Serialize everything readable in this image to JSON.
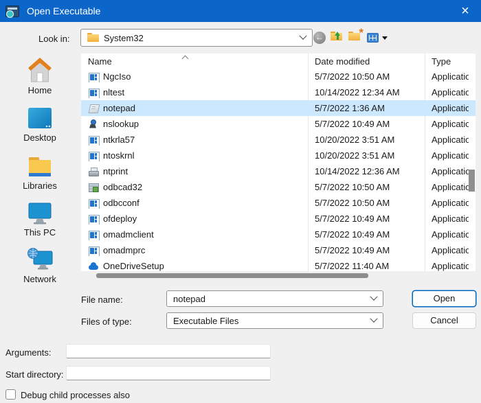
{
  "colors": {
    "titlebar": "#0c66ca",
    "selection": "#cce8ff",
    "accent": "#0067c0"
  },
  "window": {
    "title": "Open Executable",
    "close_glyph": "×"
  },
  "toolbar": {
    "look_in_label": "Look in:",
    "look_in_value": "System32",
    "nav_buttons": [
      "back-icon",
      "up-one-level-icon",
      "create-new-folder-icon",
      "view-menu-icon"
    ]
  },
  "sidebar": {
    "items": [
      {
        "label": "Home",
        "icon": "home-icon"
      },
      {
        "label": "Desktop",
        "icon": "desktop-icon"
      },
      {
        "label": "Libraries",
        "icon": "libraries-icon"
      },
      {
        "label": "This PC",
        "icon": "this-pc-icon"
      },
      {
        "label": "Network",
        "icon": "network-icon"
      }
    ]
  },
  "file_list": {
    "columns": [
      "Name",
      "Date modified",
      "Type"
    ],
    "sort_column": "Name",
    "sort_direction": "ascending",
    "rows": [
      {
        "name": "NgcIso",
        "date": "5/7/2022 10:50 AM",
        "type": "Application",
        "icon": "app"
      },
      {
        "name": "nltest",
        "date": "10/14/2022 12:34 AM",
        "type": "Application",
        "icon": "app"
      },
      {
        "name": "notepad",
        "date": "5/7/2022 1:36 AM",
        "type": "Application",
        "icon": "notepad",
        "selected": true
      },
      {
        "name": "nslookup",
        "date": "5/7/2022 10:49 AM",
        "type": "Application",
        "icon": "console"
      },
      {
        "name": "ntkrla57",
        "date": "10/20/2022 3:51 AM",
        "type": "Application",
        "icon": "app"
      },
      {
        "name": "ntoskrnl",
        "date": "10/20/2022 3:51 AM",
        "type": "Application",
        "icon": "app"
      },
      {
        "name": "ntprint",
        "date": "10/14/2022 12:36 AM",
        "type": "Application",
        "icon": "printer"
      },
      {
        "name": "odbcad32",
        "date": "5/7/2022 10:50 AM",
        "type": "Application",
        "icon": "odbc"
      },
      {
        "name": "odbcconf",
        "date": "5/7/2022 10:50 AM",
        "type": "Application",
        "icon": "app"
      },
      {
        "name": "ofdeploy",
        "date": "5/7/2022 10:49 AM",
        "type": "Application",
        "icon": "app"
      },
      {
        "name": "omadmclient",
        "date": "5/7/2022 10:49 AM",
        "type": "Application",
        "icon": "app"
      },
      {
        "name": "omadmprc",
        "date": "5/7/2022 10:49 AM",
        "type": "Application",
        "icon": "app"
      },
      {
        "name": "OneDriveSetup",
        "date": "5/7/2022 11:40 AM",
        "type": "Application",
        "icon": "onedrive"
      }
    ]
  },
  "footer": {
    "file_name_label": "File name:",
    "file_name_value": "notepad",
    "files_of_type_label": "Files of type:",
    "files_of_type_value": "Executable Files",
    "open_label": "Open",
    "cancel_label": "Cancel"
  },
  "debug_options": {
    "arguments_label": "Arguments:",
    "arguments_value": "",
    "start_directory_label": "Start directory:",
    "start_directory_value": "",
    "debug_children_label": "Debug child processes also",
    "debug_children_checked": false
  }
}
